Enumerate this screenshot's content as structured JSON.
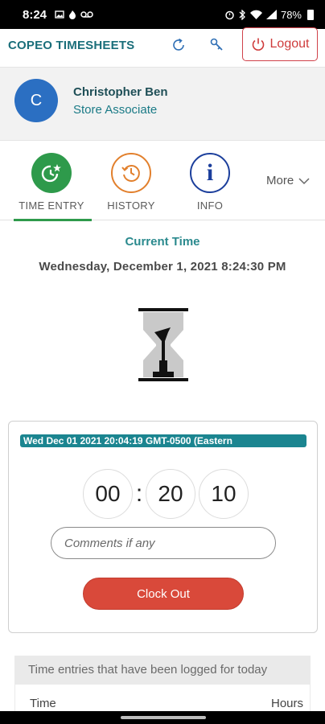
{
  "status_bar": {
    "time": "8:24",
    "battery": "78%"
  },
  "header": {
    "title": "COPEO TIMESHEETS",
    "logout_label": "Logout"
  },
  "profile": {
    "avatar_initial": "C",
    "name": "Christopher Ben",
    "role": "Store Associate"
  },
  "tabs": [
    {
      "label": "TIME ENTRY",
      "icon": "clock-star-icon",
      "active": true
    },
    {
      "label": "HISTORY",
      "icon": "history-icon",
      "active": false
    },
    {
      "label": "INFO",
      "icon": "info-icon",
      "glyph": "i",
      "active": false
    }
  ],
  "more_label": "More",
  "current_time": {
    "label": "Current Time",
    "value": "Wednesday, December 1, 2021 8:24:30 PM"
  },
  "clock_card": {
    "start_banner": "Wed Dec 01 2021 20:04:19 GMT-0500 (Eastern",
    "timer": {
      "hours": "00",
      "minutes": "20",
      "seconds": "10",
      "separator": ":"
    },
    "comments_placeholder": "Comments if any",
    "clock_out_label": "Clock Out"
  },
  "entries": {
    "header": "Time entries that have been logged for today",
    "col_time": "Time",
    "col_hours": "Hours"
  },
  "colors": {
    "brand_teal": "#1a6e7a",
    "active_green": "#2e9a4b",
    "history_orange": "#e2802d",
    "info_blue": "#1c3f9c",
    "clock_out_red": "#d9493a"
  }
}
